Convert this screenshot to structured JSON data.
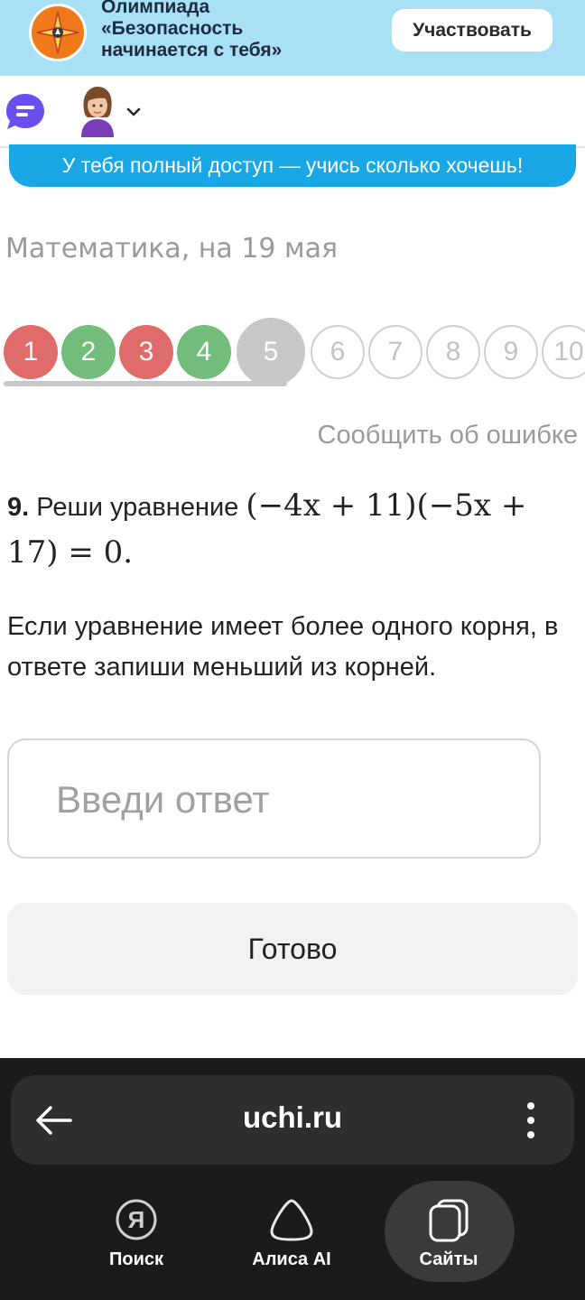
{
  "banner": {
    "lines": [
      "Олимпиада",
      "«Безопасность",
      "начинается с тебя»"
    ],
    "button": "Участвовать"
  },
  "access_strip": "У тебя полный доступ — учись сколько хочешь!",
  "subject_title": "Математика, на 19 мая",
  "tasks": [
    {
      "label": "1",
      "state": "wrong"
    },
    {
      "label": "2",
      "state": "correct"
    },
    {
      "label": "3",
      "state": "wrong"
    },
    {
      "label": "4",
      "state": "correct"
    },
    {
      "label": "5",
      "state": "current"
    },
    {
      "label": "6",
      "state": "empty"
    },
    {
      "label": "7",
      "state": "empty"
    },
    {
      "label": "8",
      "state": "empty"
    },
    {
      "label": "9",
      "state": "empty"
    },
    {
      "label": "10",
      "state": "empty"
    }
  ],
  "report_error": "Сообщить об ошибке",
  "question": {
    "number": "9.",
    "text": "Реши уравнение",
    "equation_part1": "(−4x + 11)(−5x +",
    "equation_part2": "17) = 0.",
    "hint": "Если уравнение имеет более одного корня, в ответе запиши меньший из корней."
  },
  "answer_placeholder": "Введи ответ",
  "done_button": "Готово",
  "browser": {
    "url": "uchi.ru",
    "nav": [
      {
        "label": "Поиск",
        "icon": "yandex-search-icon"
      },
      {
        "label": "Алиса AI",
        "icon": "alice-icon"
      },
      {
        "label": "Сайты",
        "icon": "tabs-icon",
        "active": true
      }
    ]
  },
  "colors": {
    "banner_bg": "#a8e1f6",
    "access_bg": "#1aa7e6",
    "wrong": "#e06b6b",
    "correct": "#73bd7b",
    "current": "#c8c8c8",
    "chat_icon": "#6a4ef0"
  }
}
